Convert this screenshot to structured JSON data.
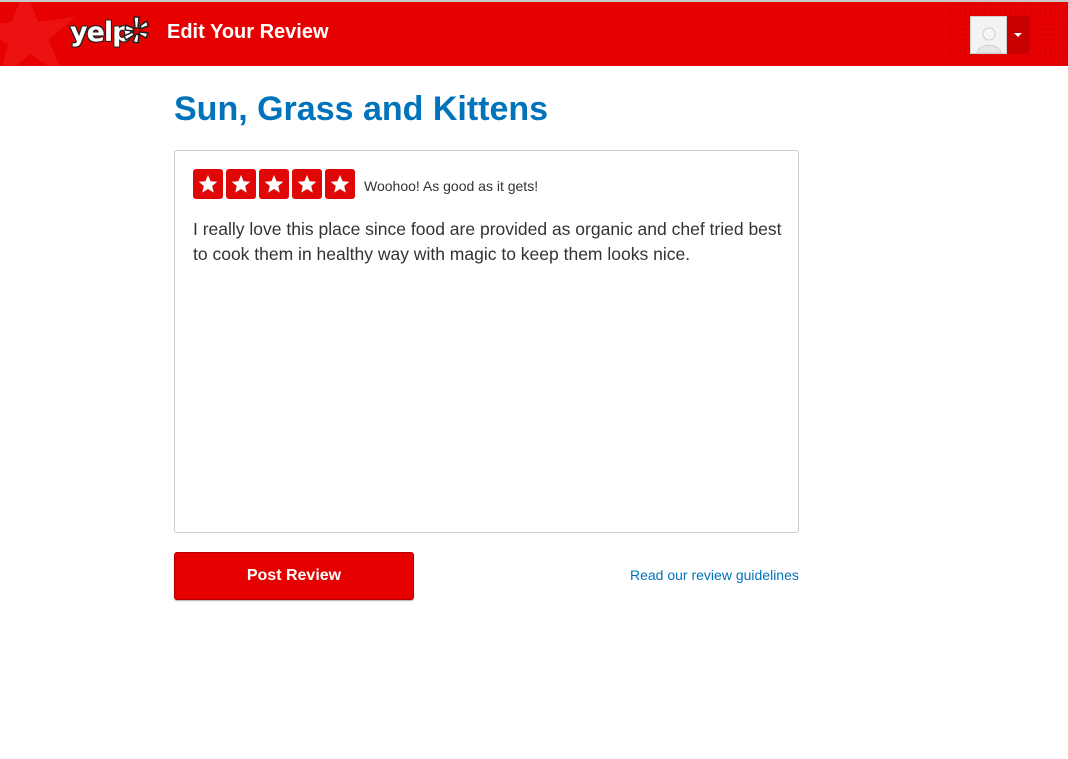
{
  "header": {
    "logo_text": "yelp",
    "title": "Edit Your Review",
    "brand_color": "#e60000"
  },
  "business": {
    "name": "Sun, Grass and Kittens"
  },
  "review": {
    "rating": 5,
    "rating_max": 5,
    "rating_label": "Woohoo! As good as it gets!",
    "text": "I really love this place since food are provided as organic and chef tried best to cook them in healthy way with magic to keep them looks nice."
  },
  "actions": {
    "post_label": "Post Review",
    "guidelines_link": "Read our review guidelines"
  },
  "icons": {
    "user_menu": "avatar-placeholder-icon",
    "dropdown": "caret-down-icon",
    "star": "star-icon"
  },
  "colors": {
    "title": "#0073bb",
    "link": "#0073bb",
    "star": "#e00707"
  }
}
